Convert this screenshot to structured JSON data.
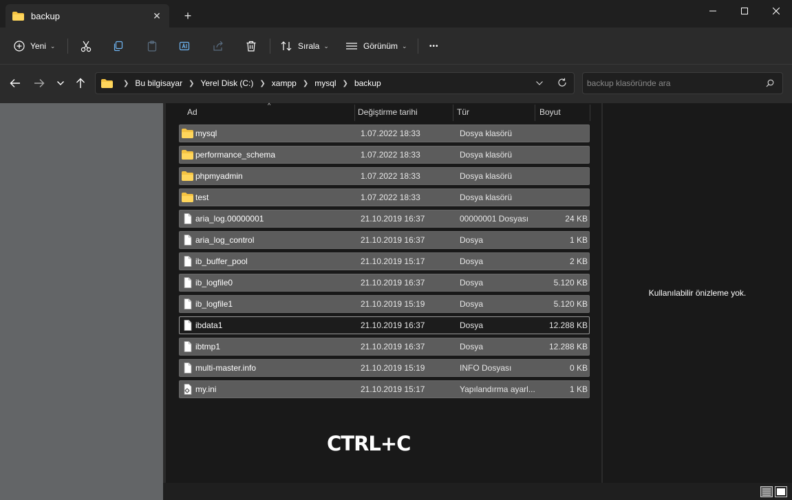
{
  "window": {
    "tab_title": "backup",
    "tab_close": "✕",
    "new_tab": "+"
  },
  "toolbar": {
    "new_label": "Yeni",
    "sort_label": "Sırala",
    "view_label": "Görünüm",
    "more": "•••"
  },
  "breadcrumb": [
    "Bu bilgisayar",
    "Yerel Disk (C:)",
    "xampp",
    "mysql",
    "backup"
  ],
  "search": {
    "placeholder": "backup klasöründe ara"
  },
  "columns": {
    "name": "Ad",
    "date": "Değiştirme tarihi",
    "type": "Tür",
    "size": "Boyut"
  },
  "files": [
    {
      "icon": "folder-icon",
      "name": "mysql",
      "date": "1.07.2022 18:33",
      "type": "Dosya klasörü",
      "size": ""
    },
    {
      "icon": "folder-icon",
      "name": "performance_schema",
      "date": "1.07.2022 18:33",
      "type": "Dosya klasörü",
      "size": ""
    },
    {
      "icon": "folder-icon",
      "name": "phpmyadmin",
      "date": "1.07.2022 18:33",
      "type": "Dosya klasörü",
      "size": ""
    },
    {
      "icon": "folder-icon",
      "name": "test",
      "date": "1.07.2022 18:33",
      "type": "Dosya klasörü",
      "size": ""
    },
    {
      "icon": "file-icon",
      "name": "aria_log.00000001",
      "date": "21.10.2019 16:37",
      "type": "00000001 Dosyası",
      "size": "24 KB"
    },
    {
      "icon": "file-icon",
      "name": "aria_log_control",
      "date": "21.10.2019 16:37",
      "type": "Dosya",
      "size": "1 KB"
    },
    {
      "icon": "file-icon",
      "name": "ib_buffer_pool",
      "date": "21.10.2019 15:17",
      "type": "Dosya",
      "size": "2 KB"
    },
    {
      "icon": "file-icon",
      "name": "ib_logfile0",
      "date": "21.10.2019 16:37",
      "type": "Dosya",
      "size": "5.120 KB"
    },
    {
      "icon": "file-icon",
      "name": "ib_logfile1",
      "date": "21.10.2019 15:19",
      "type": "Dosya",
      "size": "5.120 KB"
    },
    {
      "icon": "file-icon",
      "name": "ibdata1",
      "date": "21.10.2019 16:37",
      "type": "Dosya",
      "size": "12.288 KB",
      "focused": true
    },
    {
      "icon": "file-icon",
      "name": "ibtmp1",
      "date": "21.10.2019 16:37",
      "type": "Dosya",
      "size": "12.288 KB"
    },
    {
      "icon": "file-icon",
      "name": "multi-master.info",
      "date": "21.10.2019 15:19",
      "type": "INFO Dosyası",
      "size": "0 KB"
    },
    {
      "icon": "settings-file-icon",
      "name": "my.ini",
      "date": "21.10.2019 15:17",
      "type": "Yapılandırma ayarl...",
      "size": "1 KB"
    }
  ],
  "preview_text": "Kullanılabilir önizleme yok.",
  "overlay_text": "CTRL+C",
  "colors": {
    "folder": "#f5c342",
    "row_selected": "#5c5c5c",
    "nav_pane": "#636567"
  }
}
